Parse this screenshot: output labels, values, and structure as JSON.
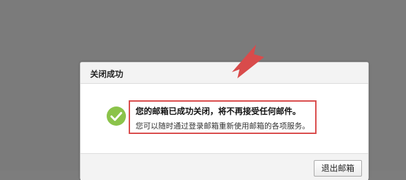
{
  "dialog": {
    "title": "关闭成功",
    "message_main": "您的邮箱已成功关闭，将不再接受任何邮件。",
    "message_sub": "您可以随时通过登录邮箱重新使用邮箱的各项服务。",
    "exit_button_label": "退出邮箱"
  },
  "icons": {
    "success": "check-circle-icon",
    "annotation": "red-arrow-icon"
  },
  "colors": {
    "overlay": "#7b7b7b",
    "success_green": "#8bc34a",
    "annotation_red": "#d94b4b"
  }
}
